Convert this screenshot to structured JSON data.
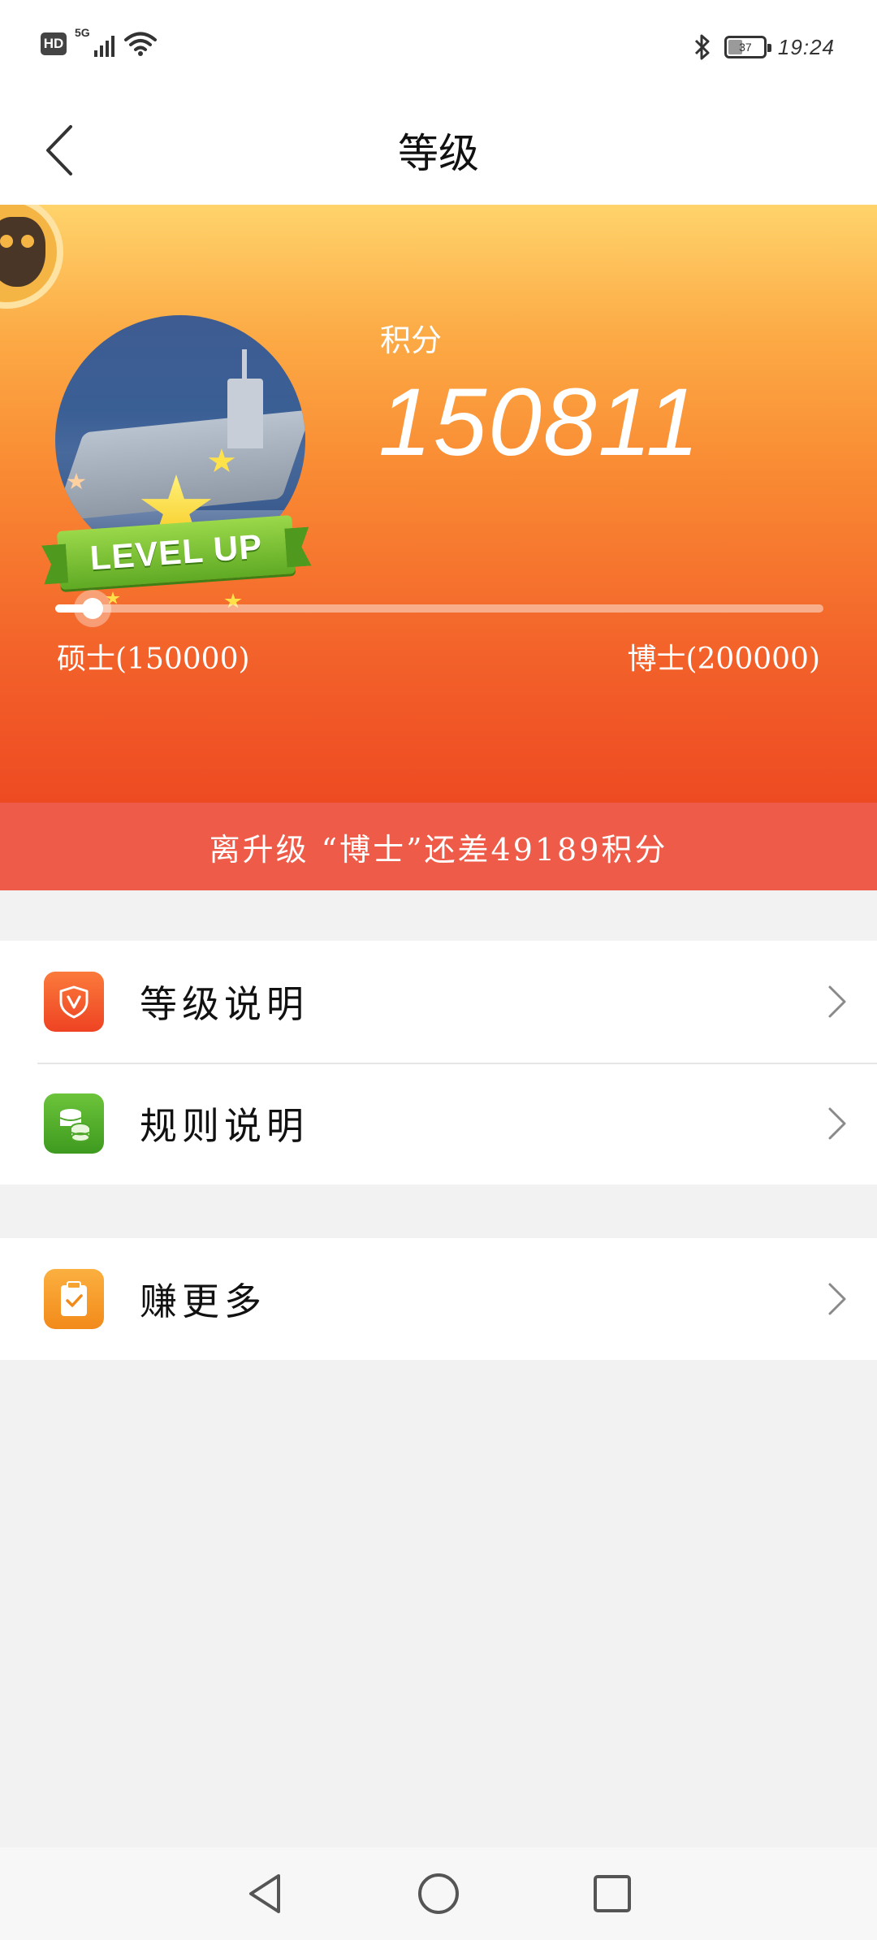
{
  "status_bar": {
    "hd": "HD",
    "network": "5G",
    "battery": "37",
    "time": "19:24"
  },
  "header": {
    "title": "等级"
  },
  "hero": {
    "points_label": "积分",
    "points_value": "150811",
    "badge_text": "LEVEL UP",
    "progress_fraction": 0.0162,
    "current_level": "硕士(150000)",
    "next_level": "博士(200000)",
    "gap_message": "离升级 “博士”还差49189积分"
  },
  "menu": {
    "group1": [
      {
        "label": "等级说明",
        "icon": "shield-v-icon",
        "color": "#f4552b"
      },
      {
        "label": "规则说明",
        "icon": "coins-icon",
        "color": "#4caf2a"
      }
    ],
    "group2": [
      {
        "label": "赚更多",
        "icon": "clipboard-check-icon",
        "color": "#f59b23"
      }
    ]
  },
  "system_nav": {
    "back": "back-icon",
    "home": "home-icon",
    "recents": "recents-icon"
  }
}
